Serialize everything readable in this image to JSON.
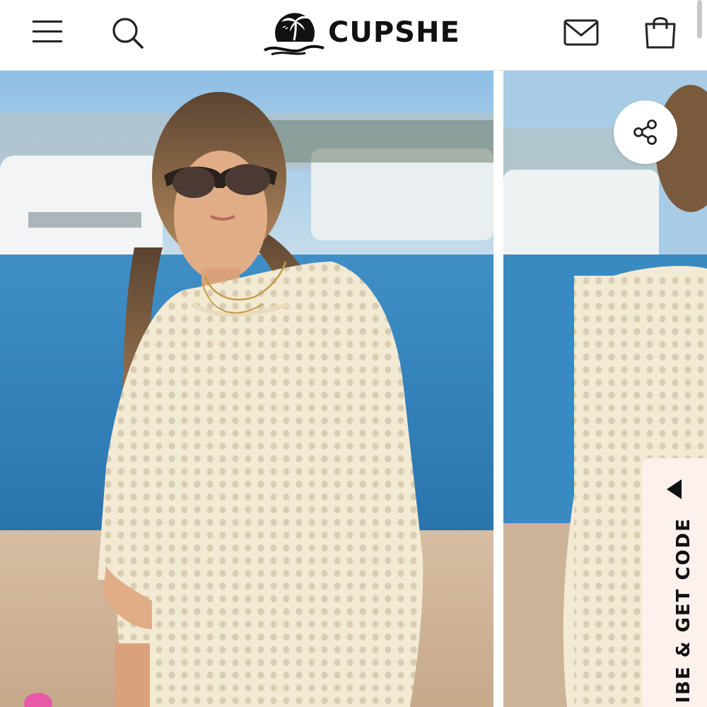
{
  "header": {
    "brand": "CUPSHE",
    "icons": [
      "menu-icon",
      "search-icon",
      "mail-icon",
      "shopping-bag-icon"
    ]
  },
  "gallery": {
    "share_icon": "share-icon"
  },
  "subscribe_tab": {
    "label": "IBE & GET CODE",
    "arrow_icon": "triangle-up-icon"
  },
  "colors": {
    "brand_text": "#111111",
    "sky": "#9cc6e4",
    "water": "#2f7fb8",
    "sand": "#cdb39a",
    "crochet": "#f1e9d2",
    "subscribe_bg": "#fdf1ee"
  }
}
